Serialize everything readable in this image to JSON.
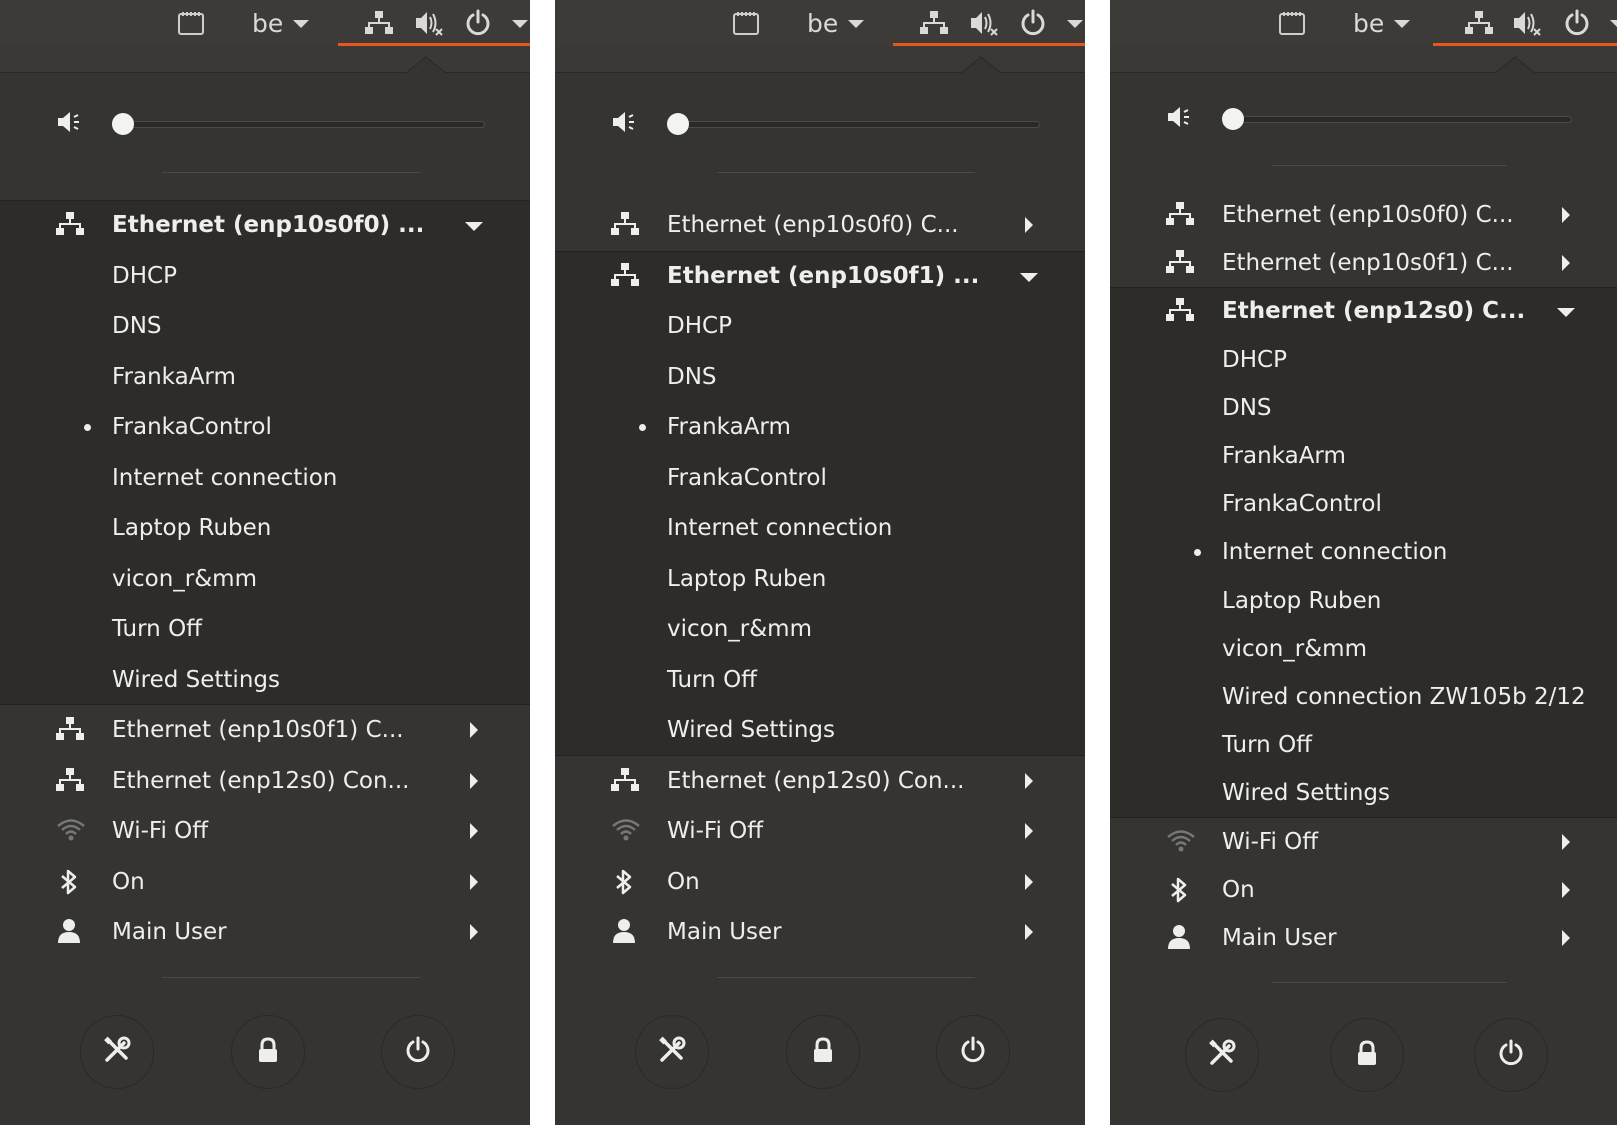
{
  "colors": {
    "panel_bg": "#353431",
    "topbar_bg": "#3c3b37",
    "accent": "#e9541f",
    "text": "#eeeeec"
  },
  "panels": [
    {
      "topbar": {
        "keyboard_layout": "be"
      },
      "volume": {
        "level": 0.0,
        "muted": true
      },
      "items": [
        {
          "label": "Ethernet (enp10s0f0) ...",
          "icon": "network-wired-icon",
          "expanded": true,
          "subitems": [
            {
              "label": "DHCP",
              "active": false
            },
            {
              "label": "DNS",
              "active": false
            },
            {
              "label": "FrankaArm",
              "active": false
            },
            {
              "label": "FrankaControl",
              "active": true
            },
            {
              "label": "Internet connection",
              "active": false
            },
            {
              "label": "Laptop Ruben",
              "active": false
            },
            {
              "label": "vicon_r&mm",
              "active": false
            },
            {
              "label": "Turn Off",
              "active": false
            },
            {
              "label": "Wired Settings",
              "active": false
            }
          ]
        },
        {
          "label": "Ethernet (enp10s0f1) C...",
          "icon": "network-wired-icon",
          "expanded": false
        },
        {
          "label": "Ethernet (enp12s0) Con...",
          "icon": "network-wired-icon",
          "expanded": false
        },
        {
          "label": "Wi-Fi Off",
          "icon": "wifi-icon",
          "expanded": false
        },
        {
          "label": "On",
          "icon": "bluetooth-icon",
          "expanded": false
        },
        {
          "label": "Main User",
          "icon": "user-icon",
          "expanded": false
        }
      ]
    },
    {
      "topbar": {
        "keyboard_layout": "be"
      },
      "volume": {
        "level": 0.0,
        "muted": true
      },
      "items": [
        {
          "label": "Ethernet (enp10s0f0) C...",
          "icon": "network-wired-icon",
          "expanded": false
        },
        {
          "label": "Ethernet (enp10s0f1) ...",
          "icon": "network-wired-icon",
          "expanded": true,
          "subitems": [
            {
              "label": "DHCP",
              "active": false
            },
            {
              "label": "DNS",
              "active": false
            },
            {
              "label": "FrankaArm",
              "active": true
            },
            {
              "label": "FrankaControl",
              "active": false
            },
            {
              "label": "Internet connection",
              "active": false
            },
            {
              "label": "Laptop Ruben",
              "active": false
            },
            {
              "label": "vicon_r&mm",
              "active": false
            },
            {
              "label": "Turn Off",
              "active": false
            },
            {
              "label": "Wired Settings",
              "active": false
            }
          ]
        },
        {
          "label": "Ethernet (enp12s0) Con...",
          "icon": "network-wired-icon",
          "expanded": false
        },
        {
          "label": "Wi-Fi Off",
          "icon": "wifi-icon",
          "expanded": false
        },
        {
          "label": "On",
          "icon": "bluetooth-icon",
          "expanded": false
        },
        {
          "label": "Main User",
          "icon": "user-icon",
          "expanded": false
        }
      ]
    },
    {
      "topbar": {
        "keyboard_layout": "be"
      },
      "volume": {
        "level": 0.0,
        "muted": true
      },
      "items": [
        {
          "label": "Ethernet (enp10s0f0) C...",
          "icon": "network-wired-icon",
          "expanded": false
        },
        {
          "label": "Ethernet (enp10s0f1) C...",
          "icon": "network-wired-icon",
          "expanded": false
        },
        {
          "label": "Ethernet (enp12s0) C...",
          "icon": "network-wired-icon",
          "expanded": true,
          "subitems": [
            {
              "label": "DHCP",
              "active": false
            },
            {
              "label": "DNS",
              "active": false
            },
            {
              "label": "FrankaArm",
              "active": false
            },
            {
              "label": "FrankaControl",
              "active": false
            },
            {
              "label": "Internet connection",
              "active": true
            },
            {
              "label": "Laptop Ruben",
              "active": false
            },
            {
              "label": "vicon_r&mm",
              "active": false
            },
            {
              "label": "Wired connection ZW105b 2/12",
              "active": false
            },
            {
              "label": "Turn Off",
              "active": false
            },
            {
              "label": "Wired Settings",
              "active": false
            }
          ]
        },
        {
          "label": "Wi-Fi Off",
          "icon": "wifi-icon",
          "expanded": false
        },
        {
          "label": "On",
          "icon": "bluetooth-icon",
          "expanded": false
        },
        {
          "label": "Main User",
          "icon": "user-icon",
          "expanded": false
        }
      ]
    }
  ],
  "bottom_buttons": [
    {
      "name": "settings-button",
      "icon": "tools-icon"
    },
    {
      "name": "lock-button",
      "icon": "lock-icon"
    },
    {
      "name": "power-off-button",
      "icon": "power-icon"
    }
  ]
}
